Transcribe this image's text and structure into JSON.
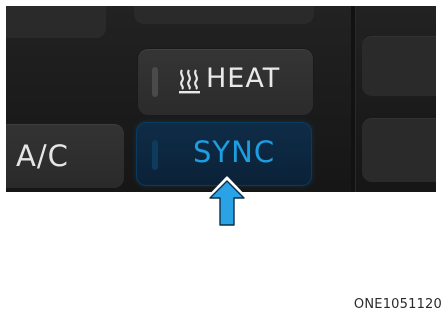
{
  "controls": {
    "heat": {
      "label": "HEAT",
      "icon": "heated-seat-icon",
      "text_color": "#e9e9e9",
      "active": false
    },
    "sync": {
      "label": "SYNC",
      "text_color": "#1d9ee0",
      "active": true
    },
    "ac": {
      "label": "A/C",
      "text_color": "#e6e6e6"
    }
  },
  "pointer": {
    "icon": "up-arrow-icon",
    "fill": "#29a3e6"
  },
  "figure_code": "ONE1051120"
}
